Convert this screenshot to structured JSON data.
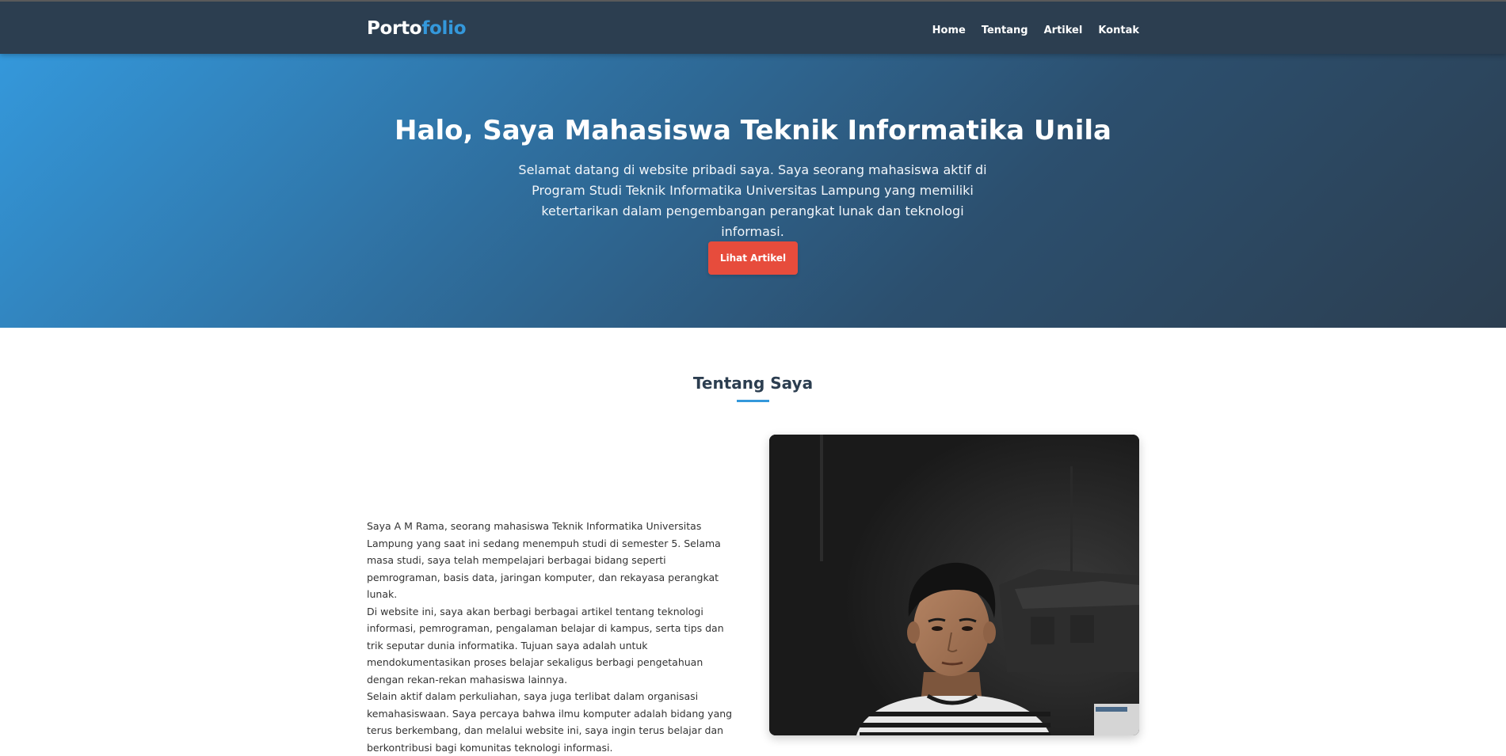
{
  "navbar": {
    "logo_part1": "Porto",
    "logo_part2": "folio",
    "links": [
      "Home",
      "Tentang",
      "Artikel",
      "Kontak"
    ]
  },
  "hero": {
    "title": "Halo, Saya Mahasiswa Teknik Informatika Unila",
    "subtitle": "Selamat datang di website pribadi saya. Saya seorang mahasiswa aktif di Program Studi Teknik Informatika Universitas Lampung yang memiliki ketertarikan dalam pengembangan perangkat lunak dan teknologi informasi.",
    "button_label": "Lihat Artikel"
  },
  "about": {
    "title": "Tentang Saya",
    "paragraphs": [
      "Saya A M Rama, seorang mahasiswa Teknik Informatika Universitas Lampung yang saat ini sedang menempuh studi di semester 5. Selama masa studi, saya telah mempelajari berbagai bidang seperti pemrograman, basis data, jaringan komputer, dan rekayasa perangkat lunak.",
      "Di website ini, saya akan berbagi berbagai artikel tentang teknologi informasi, pemrograman, pengalaman belajar di kampus, serta tips dan trik seputar dunia informatika. Tujuan saya adalah untuk mendokumentasikan proses belajar sekaligus berbagi pengetahuan dengan rekan-rekan mahasiswa lainnya.",
      "Selain aktif dalam perkuliahan, saya juga terlibat dalam organisasi kemahasiswaan. Saya percaya bahwa ilmu komputer adalah bidang yang terus berkembang, dan melalui website ini, saya ingin terus belajar dan berkontribusi bagi komunitas teknologi informasi."
    ]
  },
  "colors": {
    "nav_bg": "#2c3e50",
    "accent_blue": "#3498db",
    "button_red": "#e74c3c",
    "hero_gradient_start": "#3498db",
    "hero_gradient_end": "#2c3e50"
  }
}
